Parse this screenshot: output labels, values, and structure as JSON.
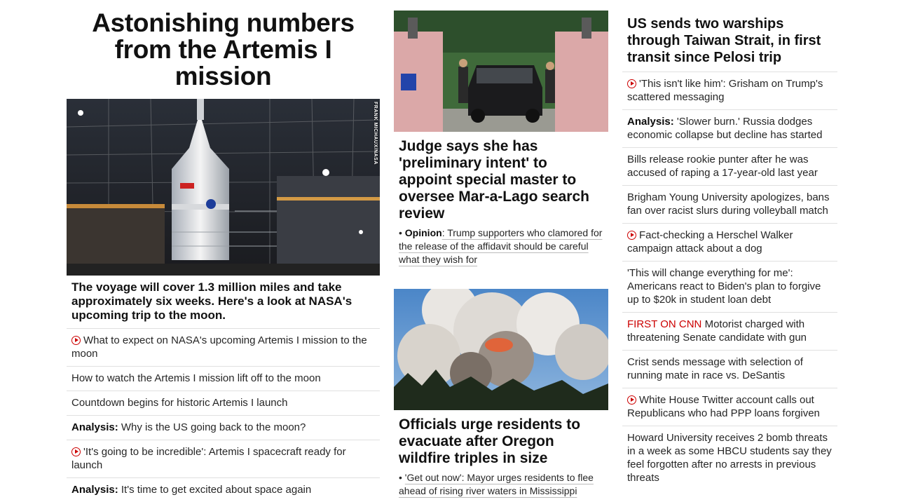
{
  "lead": {
    "title": "Astonishing numbers from the Artemis I mission",
    "image_credit": "FRANK MICHAUX/NASA",
    "caption": "The voyage will cover 1.3 million miles and take approximately six weeks. Here's a look at NASA's upcoming trip to the moon.",
    "links": [
      {
        "video": true,
        "prefix": "",
        "text": "What to expect on NASA's upcoming Artemis I mission to the moon"
      },
      {
        "video": false,
        "prefix": "",
        "text": "How to watch the Artemis I mission lift off to the moon"
      },
      {
        "video": false,
        "prefix": "",
        "text": "Countdown begins for historic Artemis I launch"
      },
      {
        "video": false,
        "prefix": "Analysis:",
        "text": " Why is the US going back to the moon?"
      },
      {
        "video": true,
        "prefix": "",
        "text": "'It's going to be incredible': Artemis I spacecraft ready for launch"
      },
      {
        "video": false,
        "prefix": "Analysis:",
        "text": " It's time to get excited about space again"
      }
    ]
  },
  "story1": {
    "title": "Judge says she has 'preliminary intent' to appoint special master to oversee Mar-a-Lago search review",
    "sub_prefix": "Opinion",
    "sub_text": ": Trump supporters who clamored for the release of the affidavit should be careful what they wish for"
  },
  "story2": {
    "title": "Officials urge residents to evacuate after Oregon wildfire triples in size",
    "sub_text": "'Get out now': Mayor urges residents to flee ahead of rising river waters in Mississippi"
  },
  "col3": {
    "title": "US sends two warships through Taiwan Strait, in first transit since Pelosi trip",
    "links": [
      {
        "video": true,
        "prefix": "",
        "red": "",
        "text": "'This isn't like him': Grisham on Trump's scattered messaging"
      },
      {
        "video": false,
        "prefix": "Analysis:",
        "red": "",
        "text": " 'Slower burn.' Russia dodges economic collapse but decline has started"
      },
      {
        "video": false,
        "prefix": "",
        "red": "",
        "text": "Bills release rookie punter after he was accused of raping a 17-year-old last year"
      },
      {
        "video": false,
        "prefix": "",
        "red": "",
        "text": "Brigham Young University apologizes, bans fan over racist slurs during volleyball match"
      },
      {
        "video": true,
        "prefix": "",
        "red": "",
        "text": "Fact-checking a Herschel Walker campaign attack about a dog"
      },
      {
        "video": false,
        "prefix": "",
        "red": "",
        "text": "'This will change everything for me': Americans react to Biden's plan to forgive up to $20k in student loan debt"
      },
      {
        "video": false,
        "prefix": "",
        "red": "FIRST ON CNN",
        "text": " Motorist charged with threatening Senate candidate with gun"
      },
      {
        "video": false,
        "prefix": "",
        "red": "",
        "text": "Crist sends message with selection of running mate in race vs. DeSantis"
      },
      {
        "video": true,
        "prefix": "",
        "red": "",
        "text": "White House Twitter account calls out Republicans who had PPP loans forgiven"
      },
      {
        "video": false,
        "prefix": "",
        "red": "",
        "text": "Howard University receives 2 bomb threats in a week as some HBCU students say they feel forgotten after no arrests in previous threats"
      }
    ]
  },
  "colors": {
    "accent": "#cc0000",
    "divider": "#e0e0e0",
    "text": "#262626"
  }
}
